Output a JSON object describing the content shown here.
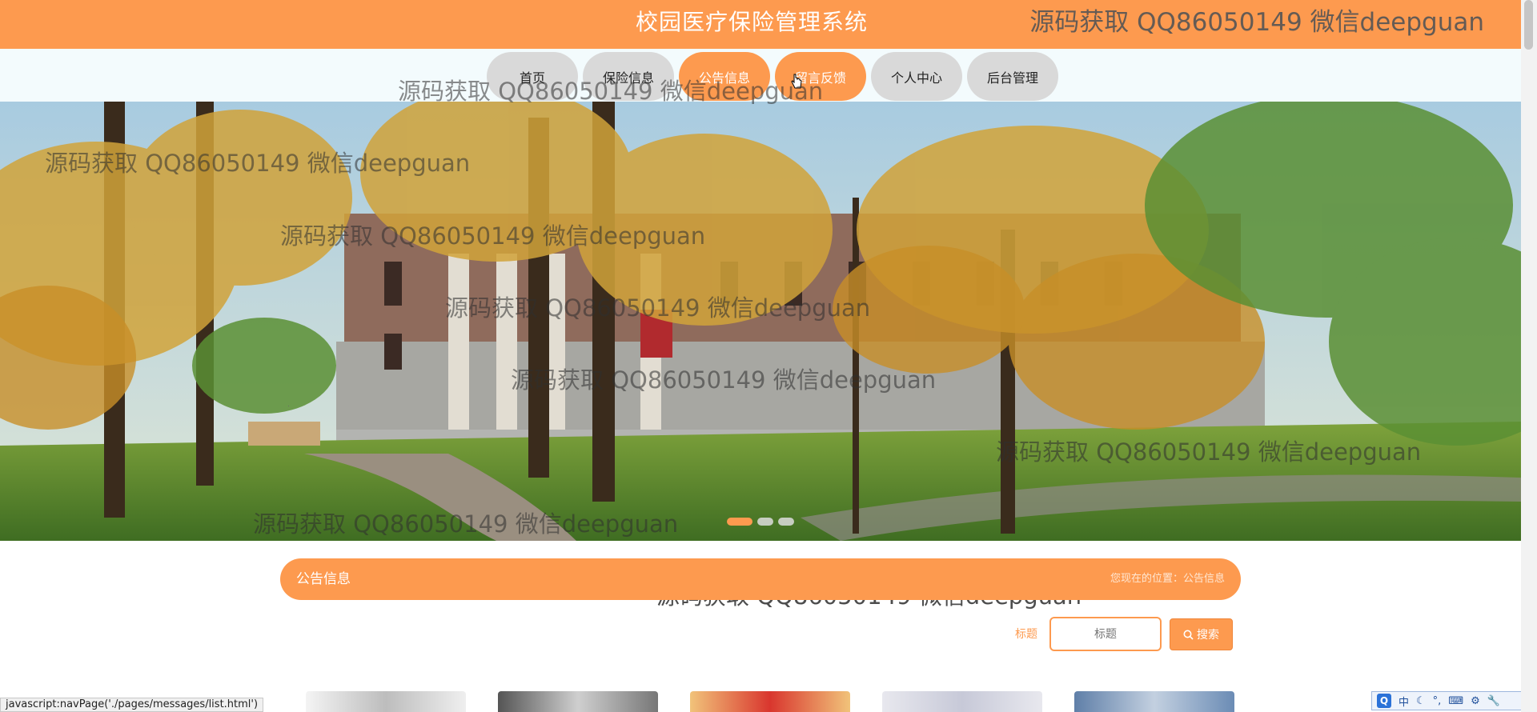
{
  "header": {
    "title": "校园医疗保险管理系统",
    "watermark": "源码获取 QQ86050149 微信deepguan"
  },
  "nav": {
    "items": [
      {
        "label": "首页"
      },
      {
        "label": "保险信息"
      },
      {
        "label": "公告信息"
      },
      {
        "label": "留言反馈"
      },
      {
        "label": "个人中心"
      },
      {
        "label": "后台管理"
      }
    ],
    "active_index": 2,
    "hover_index": 3
  },
  "banner": {
    "slides_count": 3,
    "active_slide": 1
  },
  "watermarks": [
    "源码获取 QQ86050149 微信deepguan",
    "源码获取 QQ86050149 微信deepguan",
    "源码获取 QQ86050149 微信deepguan",
    "源码获取 QQ86050149 微信deepguan",
    "源码获取 QQ86050149 微信deepguan",
    "源码获取 QQ86050149 微信deepguan",
    "源码获取 QQ86050149 微信deepguan",
    "源码获取 QQ86050149 微信deepguan"
  ],
  "section": {
    "title": "公告信息",
    "breadcrumb": "您现在的位置：公告信息"
  },
  "search": {
    "label": "标题",
    "placeholder": "标题",
    "button_label": "搜索"
  },
  "status_bar": {
    "text": "javascript:navPage('./pages/messages/list.html')"
  },
  "ime": {
    "logo": "Q",
    "mode": "中"
  },
  "colors": {
    "primary": "#fd9a4f",
    "nav_inactive": "#d9d9d9",
    "nav_bg": "#f3fbfd"
  }
}
